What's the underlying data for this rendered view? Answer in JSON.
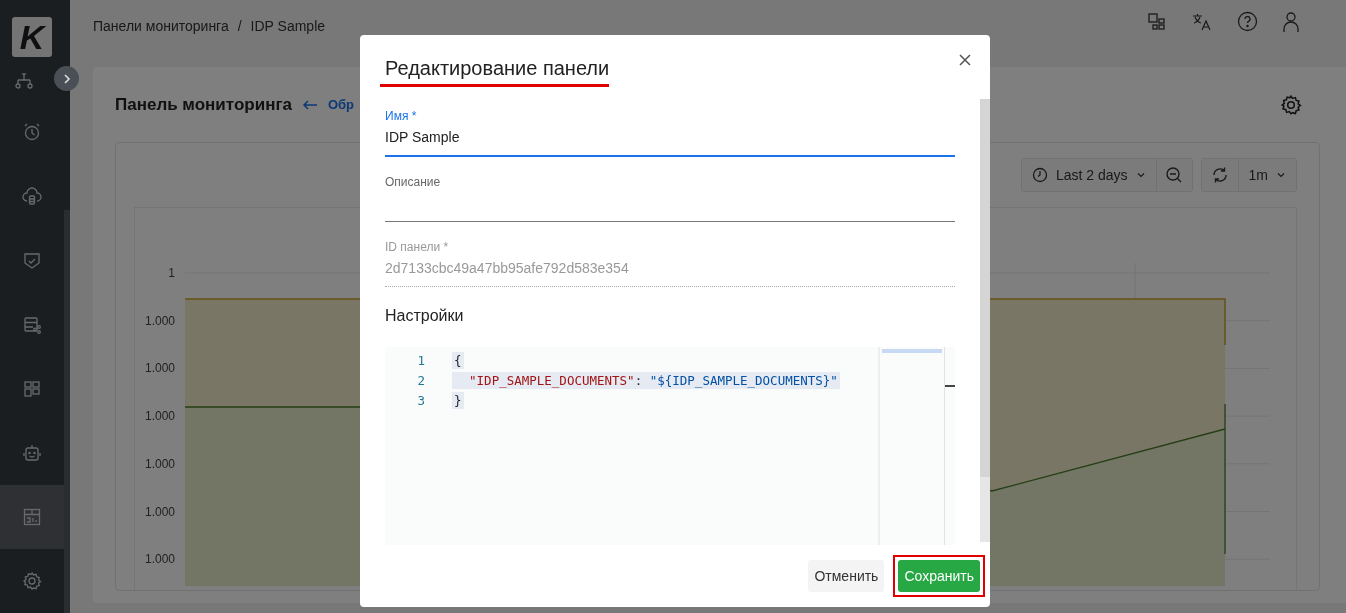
{
  "sidebar": {
    "logo": "K",
    "items": [
      {
        "kind": "network",
        "selected": false
      },
      {
        "kind": "alarm",
        "selected": false
      },
      {
        "kind": "cloud",
        "selected": false
      },
      {
        "kind": "shield",
        "selected": false
      },
      {
        "kind": "server",
        "selected": false
      },
      {
        "kind": "grid",
        "selected": false
      },
      {
        "kind": "robot",
        "selected": false
      },
      {
        "kind": "dashboard",
        "selected": true
      },
      {
        "kind": "settings",
        "selected": false
      }
    ]
  },
  "breadcrumb": [
    "Панели мониторинга",
    "IDP Sample"
  ],
  "breadcrumb_separator": "/",
  "page": {
    "title": "Панель мониторинга",
    "back_link": "Обр"
  },
  "toolbar": {
    "time_range": "Last 2 days",
    "refresh_interval": "1m"
  },
  "chart": {
    "y_labels": [
      "1",
      "1.000",
      "1.000",
      "1.000",
      "1.000",
      "1.000",
      "1.000"
    ]
  },
  "dialog": {
    "title": "Редактирование панели",
    "title_underlined": true,
    "fields": [
      {
        "label": "Имя *",
        "value": "IDP Sample",
        "focused": true,
        "disabled": false
      },
      {
        "label": "Описание",
        "focused": false,
        "disabled": false
      },
      {
        "label": "ID панели *",
        "value": "2d7133cbc49a47bb95afe792d583e354",
        "focused": false,
        "disabled": true
      }
    ],
    "settings_heading": "Настройки",
    "code_lines": [
      {
        "number": "1",
        "tokens": [
          {
            "text": "{",
            "kind": "punct"
          }
        ]
      },
      {
        "number": "2",
        "tokens": [
          {
            "text": "\"IDP_SAMPLE_DOCUMENTS\"",
            "kind": "key"
          },
          {
            "text": ":",
            "kind": "punct"
          },
          {
            "text": "\"${IDP_SAMPLE_DOCUMENTS}\"",
            "kind": "string"
          }
        ]
      },
      {
        "number": "3",
        "tokens": [
          {
            "text": "}",
            "kind": "punct"
          }
        ]
      }
    ],
    "buttons": [
      {
        "label": "Отменить",
        "kind": "secondary",
        "highlighted": false
      },
      {
        "label": "Сохранить",
        "kind": "primary",
        "highlighted": true
      }
    ]
  }
}
